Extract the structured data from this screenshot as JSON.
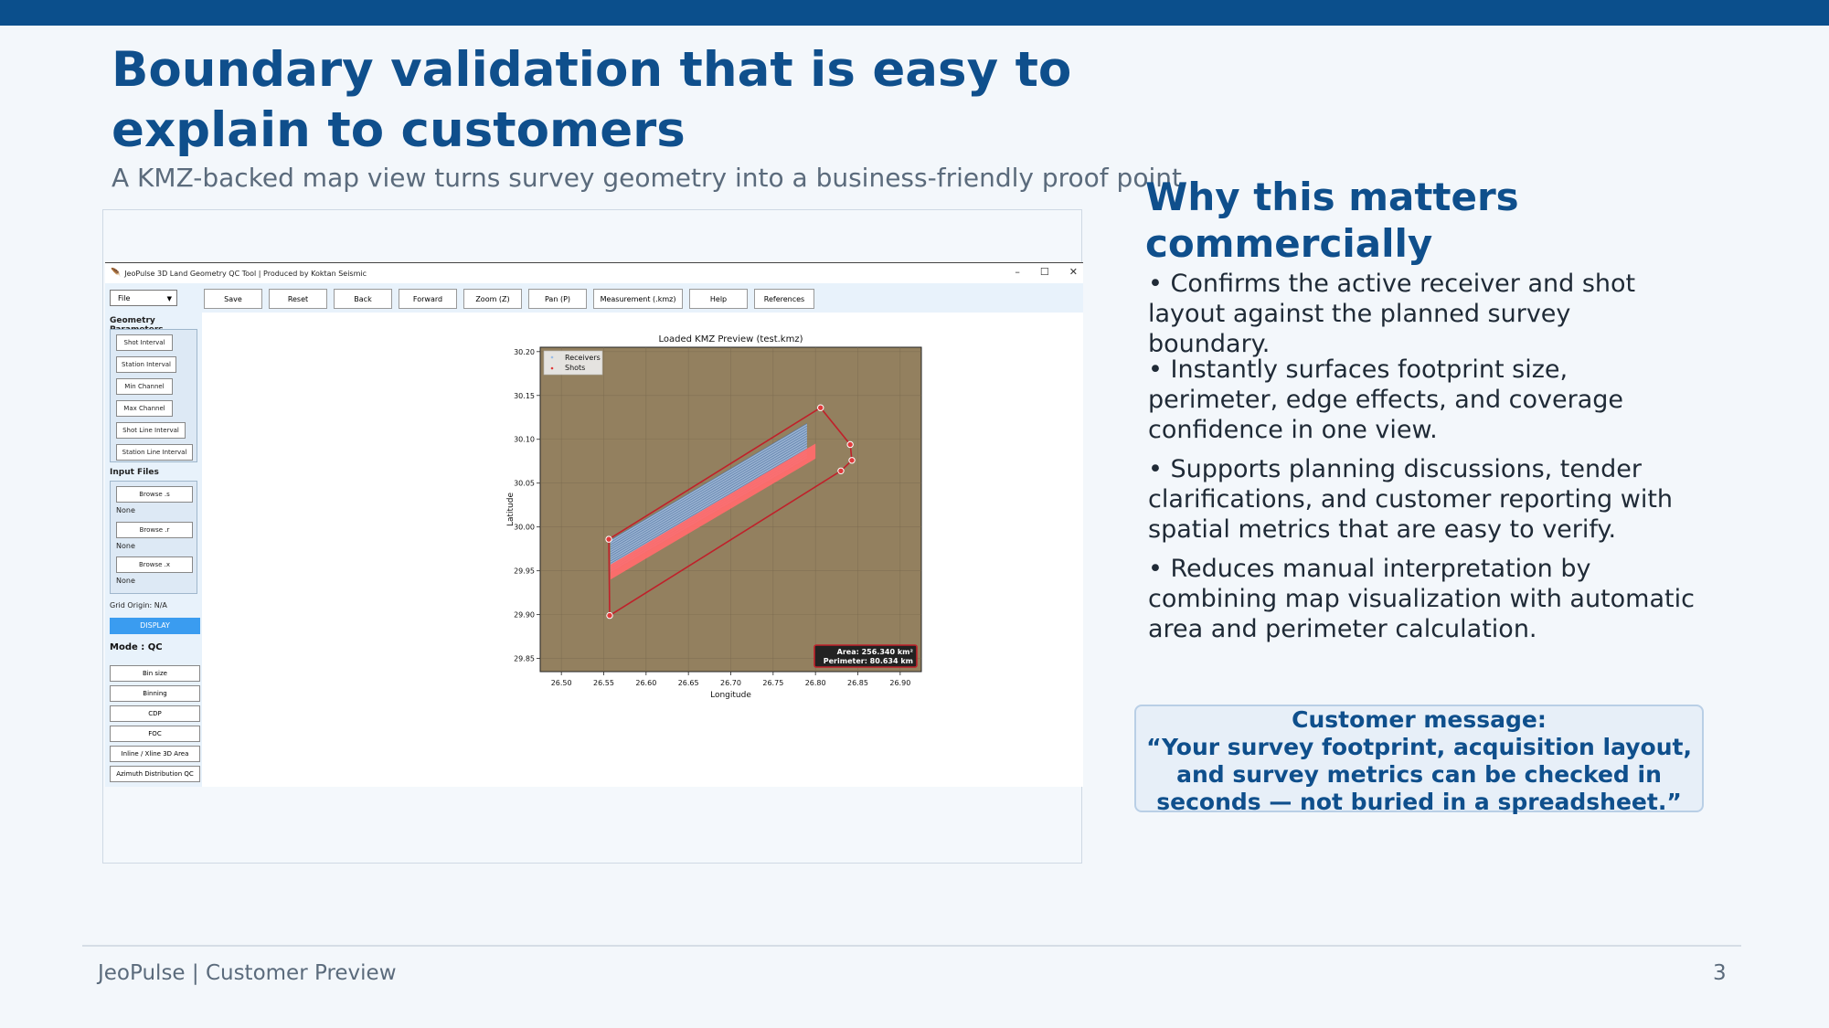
{
  "slide": {
    "title": "Boundary validation that is easy to explain to customers",
    "subtitle": "A KMZ-backed map view turns survey geometry into a business-friendly proof point",
    "footer_left": "JeoPulse | Customer Preview",
    "page_number": "3",
    "colors": {
      "topbar": "#0b4f8c",
      "title": "#0f4f8c",
      "message_bg": "#e7eff8"
    }
  },
  "app": {
    "window_title": "JeoPulse 3D Land Geometry QC Tool | Produced by Koktan Seismic",
    "window_controls": [
      "–",
      "☐",
      "✕"
    ],
    "file_menu": "File",
    "toolbar": [
      "Save",
      "Reset",
      "Back",
      "Forward",
      "Zoom (Z)",
      "Pan (P)",
      "Measurement (.kmz)",
      "Help",
      "References"
    ],
    "geometry_parameters_label": "Geometry Parameters",
    "geometry_buttons": [
      "Shot Interval",
      "Station Interval",
      "Min Channel",
      "Max Channel",
      "Shot Line Interval",
      "Station Line Interval"
    ],
    "input_files_label": "Input Files",
    "input_files": [
      {
        "button": "Browse .s",
        "status": "None"
      },
      {
        "button": "Browse .r",
        "status": "None"
      },
      {
        "button": "Browse .x",
        "status": "None"
      }
    ],
    "grid_origin": "Grid Origin: N/A",
    "display_button": "DISPLAY",
    "mode_label": "Mode : QC",
    "qc_buttons": [
      "Bin size",
      "Binning",
      "CDP",
      "FOC",
      "Inline / Xline 3D Area",
      "Azimuth Distribution QC"
    ]
  },
  "chart_data": {
    "type": "scatter",
    "title": "Loaded KMZ Preview (test.kmz)",
    "xlabel": "Longitude",
    "ylabel": "Latitude",
    "xlim": [
      26.475,
      26.925
    ],
    "ylim": [
      29.835,
      30.205
    ],
    "xticks": [
      "26.50",
      "26.55",
      "26.60",
      "26.65",
      "26.70",
      "26.75",
      "26.80",
      "26.85",
      "26.90"
    ],
    "xtick_values": [
      26.5,
      26.55,
      26.6,
      26.65,
      26.7,
      26.75,
      26.8,
      26.85,
      26.9
    ],
    "yticks": [
      "29.85",
      "29.90",
      "29.95",
      "30.00",
      "30.05",
      "30.10",
      "30.15",
      "30.20"
    ],
    "ytick_values": [
      29.85,
      29.9,
      29.95,
      30.0,
      30.05,
      30.1,
      30.15,
      30.2
    ],
    "grid": true,
    "legend": {
      "position": "top-left",
      "entries": [
        "Receivers",
        "Shots"
      ]
    },
    "series": [
      {
        "name": "Receivers",
        "color": "#9bbce6",
        "polygon": [
          [
            26.558,
            29.985
          ],
          [
            26.558,
            29.948
          ],
          [
            26.79,
            30.078
          ],
          [
            26.79,
            30.118
          ]
        ]
      },
      {
        "name": "Shots",
        "color": "#ff6b6b",
        "polygon": [
          [
            26.558,
            29.957
          ],
          [
            26.558,
            29.94
          ],
          [
            26.8,
            30.078
          ],
          [
            26.8,
            30.095
          ]
        ]
      }
    ],
    "boundary": {
      "color": "#c0202a",
      "vertices": [
        [
          26.556,
          29.986
        ],
        [
          26.806,
          30.136
        ],
        [
          26.841,
          30.094
        ],
        [
          26.843,
          30.076
        ],
        [
          26.83,
          30.064
        ],
        [
          26.557,
          29.899
        ]
      ]
    },
    "background_color": "#93805f",
    "annotations": [
      "Area: 256.340 km²",
      "Perimeter: 80.634 km"
    ]
  },
  "why": {
    "title": "Why this matters commercially",
    "bullets": [
      "• Confirms the active receiver and shot layout against the planned survey boundary.",
      "• Instantly surfaces footprint size, perimeter, edge effects, and coverage confidence in one view.",
      "• Supports planning discussions, tender clarifications, and customer reporting with spatial metrics that are easy to verify.",
      "• Reduces manual interpretation by combining map visualization with automatic area and perimeter calculation."
    ]
  },
  "message": {
    "heading": "Customer message:",
    "body": "“Your survey footprint, acquisition layout, and survey metrics can be checked in seconds — not buried in a spreadsheet.”"
  }
}
